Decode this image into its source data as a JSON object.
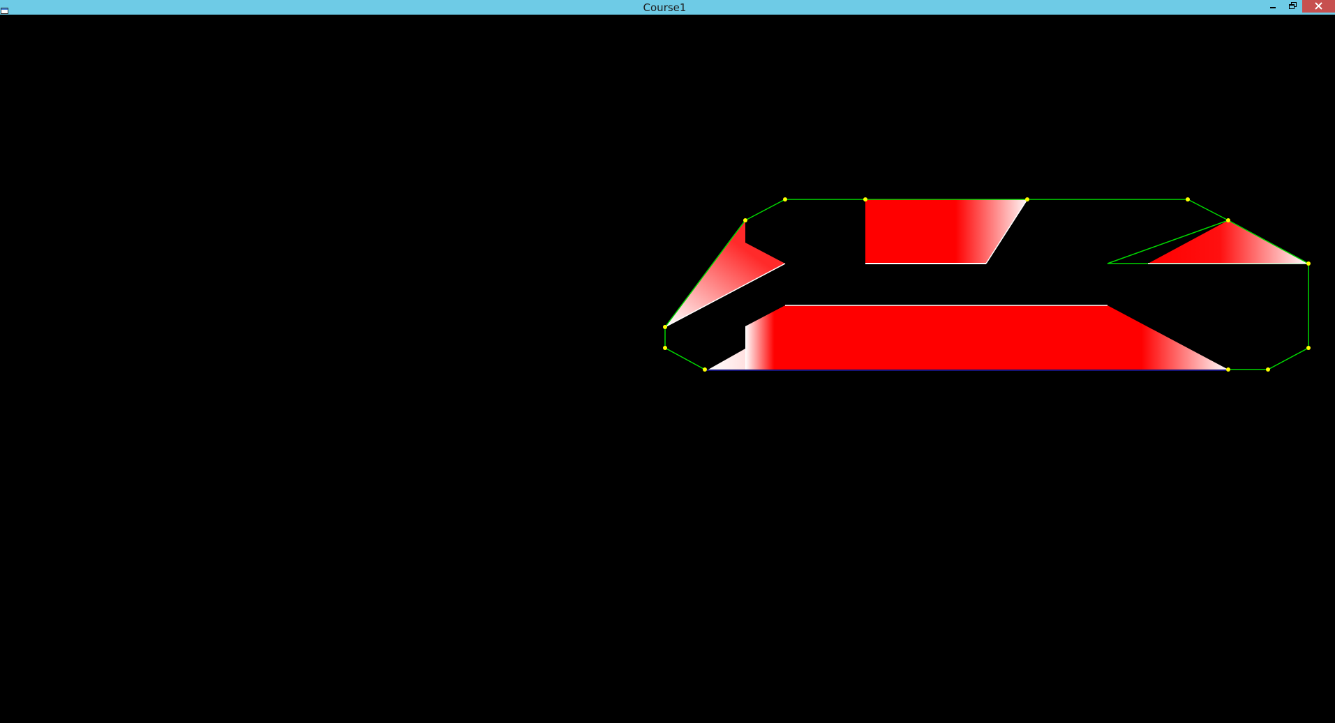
{
  "window": {
    "title": "Course1",
    "icons": {
      "app": "app-window-icon",
      "minimize": "minimize-icon",
      "restore": "restore-icon",
      "close": "close-icon"
    },
    "colors": {
      "titlebar": "#6ecbe6",
      "close_button": "#c7504f",
      "canvas_background": "#000000",
      "track_outline": "#00d800",
      "control_point": "#ffff00",
      "fill": "#ff0000",
      "highlight": "#ffffff"
    }
  }
}
